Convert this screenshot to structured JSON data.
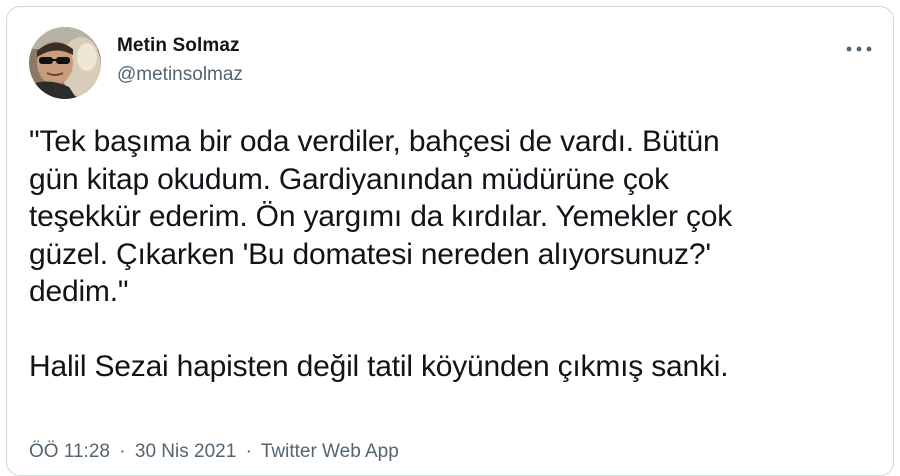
{
  "author": {
    "name": "Metin Solmaz",
    "handle": "@metinsolmaz",
    "avatar": "profile-photo"
  },
  "menu": {
    "icon": "more-horizontal-icon"
  },
  "tweet": {
    "paragraphs": [
      "\"Tek başıma bir oda verdiler, bahçesi de vardı. Bütün\ngün kitap okudum. Gardiyanından müdürüne çok\nteşekkür ederim. Ön yargımı da kırdılar. Yemekler çok\ngüzel. Çıkarken 'Bu domatesi nereden alıyorsunuz?'\ndedim.\"",
      "Halil Sezai hapisten değil tatil köyünden çıkmış sanki."
    ]
  },
  "meta": {
    "time": "ÖÖ 11:28",
    "separator": "·",
    "date": "30 Nis 2021",
    "source": "Twitter Web App"
  },
  "colors": {
    "text": "#0f1419",
    "secondary": "#536471",
    "border": "#cfd9de"
  }
}
